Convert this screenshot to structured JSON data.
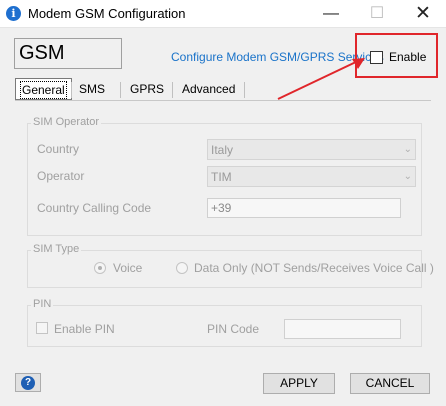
{
  "window": {
    "title": "Modem GSM Configuration",
    "app_icon": "info-icon",
    "controls": {
      "minimize": "—",
      "maximize": "☐",
      "close": "✕"
    }
  },
  "header": {
    "module_name": "GSM",
    "configure_link": "Configure Modem GSM/GPRS Services",
    "enable_label": "Enable",
    "enable_checked": false,
    "highlight_color": "#e0262b",
    "link_color": "#1a73c9"
  },
  "tabs": [
    {
      "label": "General",
      "selected": true
    },
    {
      "label": "SMS",
      "selected": false
    },
    {
      "label": "GPRS",
      "selected": false
    },
    {
      "label": "Advanced",
      "selected": false
    }
  ],
  "sim_operator": {
    "legend": "SIM Operator",
    "country_label": "Country",
    "country_value": "Italy",
    "operator_label": "Operator",
    "operator_value": "TIM",
    "calling_code_label": "Country Calling Code",
    "calling_code_value": "+39"
  },
  "sim_type": {
    "legend": "SIM Type",
    "voice_label": "Voice",
    "voice_selected": true,
    "data_only_label": "Data Only (NOT Sends/Receives Voice Call )",
    "data_only_selected": false
  },
  "pin": {
    "legend": "PIN",
    "enable_pin_label": "Enable PIN",
    "enable_pin_checked": false,
    "pin_code_label": "PIN Code",
    "pin_code_value": ""
  },
  "footer": {
    "help_icon": "question-icon",
    "apply_label": "APPLY",
    "cancel_label": "CANCEL"
  }
}
